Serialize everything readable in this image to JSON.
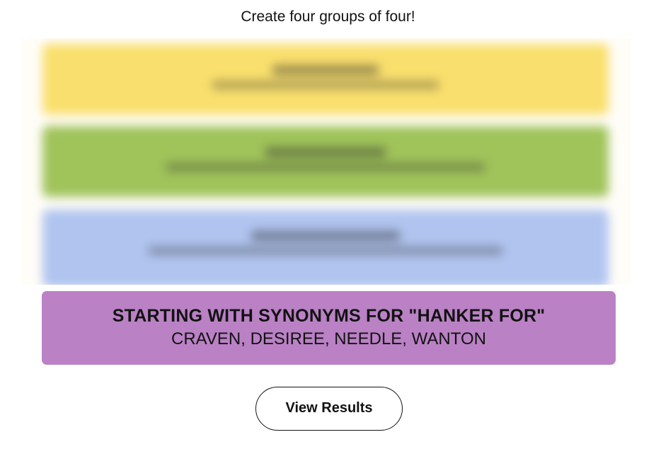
{
  "header": {
    "instructions": "Create four groups of four!"
  },
  "solved_groups": [
    {
      "color": "#f9df6d",
      "state": "blurred"
    },
    {
      "color": "#a0c35a",
      "state": "blurred"
    },
    {
      "color": "#b0c4ef",
      "state": "blurred"
    }
  ],
  "revealed_group": {
    "color": "#ba81c5",
    "title": "STARTING WITH SYNONYMS FOR \"HANKER FOR\"",
    "members": "CRAVEN, DESIREE, NEEDLE, WANTON"
  },
  "actions": {
    "view_results_label": "View Results"
  }
}
